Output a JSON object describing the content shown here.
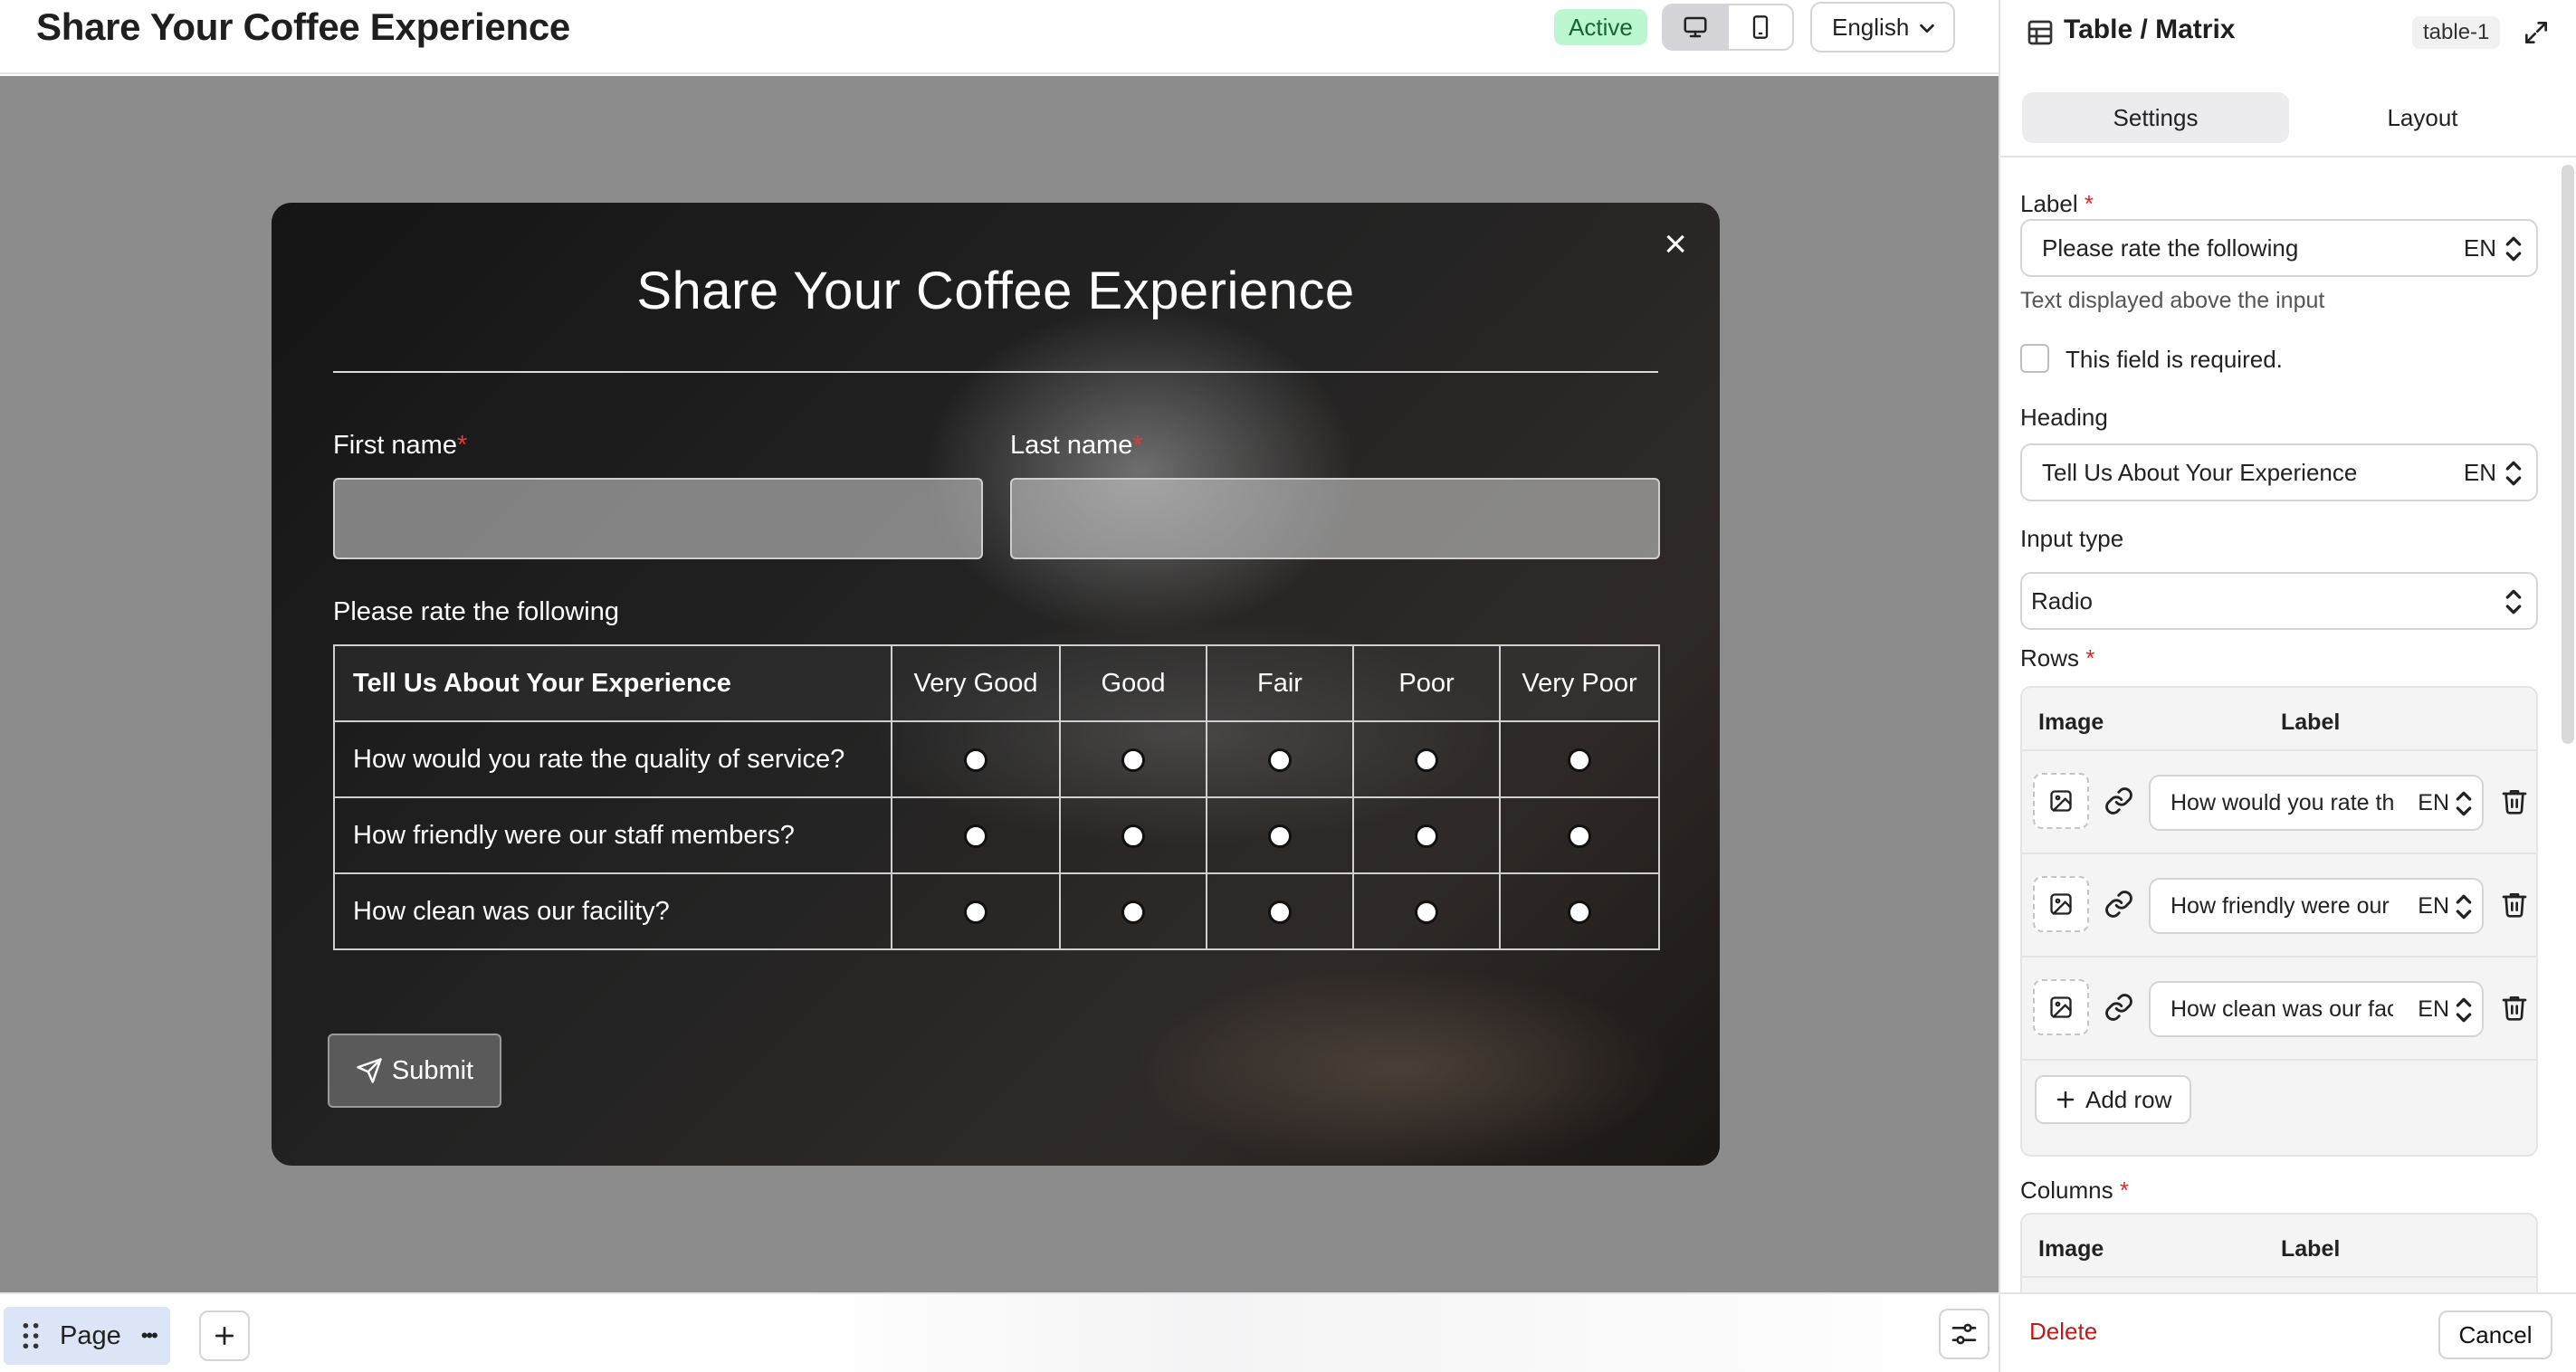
{
  "header": {
    "title": "Share Your Coffee Experience",
    "status": "Active",
    "language": "English",
    "device_modes": [
      "desktop-icon",
      "mobile-icon"
    ],
    "active_device": "desktop"
  },
  "form": {
    "title": "Share Your Coffee Experience",
    "close_symbol": "×",
    "first_name_label": "First name",
    "last_name_label": "Last name",
    "required_mark": "*",
    "rate_label": "Please rate the following",
    "matrix": {
      "heading": "Tell Us About Your Experience",
      "columns": [
        "Very Good",
        "Good",
        "Fair",
        "Poor",
        "Very Poor"
      ],
      "rows": [
        "How would you rate the quality of service?",
        "How friendly were our staff members?",
        "How clean was our facility?"
      ]
    },
    "submit_label": "Submit"
  },
  "bottom_bar": {
    "page_tab_label": "Page",
    "more_symbol": "•••"
  },
  "panel": {
    "title": "Table / Matrix",
    "id_badge": "table-1",
    "tabs": [
      {
        "label": "Settings",
        "active": true
      },
      {
        "label": "Layout",
        "active": false
      }
    ],
    "label_field": {
      "label": "Label",
      "required": "*",
      "value": "Please rate the following",
      "lang": "EN",
      "hint": "Text displayed above the input"
    },
    "required_checkbox": {
      "label": "This field is required.",
      "checked": false
    },
    "heading_field": {
      "label": "Heading",
      "value": "Tell Us About Your Experience",
      "lang": "EN"
    },
    "input_type": {
      "label": "Input type",
      "value": "Radio"
    },
    "rows_section": {
      "label": "Rows",
      "required": "*",
      "col_image": "Image",
      "col_label": "Label",
      "items": [
        {
          "text": "How would you rate the quality of service?",
          "lang": "EN"
        },
        {
          "text": "How friendly were our staff members?",
          "lang": "EN"
        },
        {
          "text": "How clean was our facility?",
          "lang": "EN"
        }
      ],
      "add_label": "Add row"
    },
    "columns_section": {
      "label": "Columns",
      "required": "*",
      "col_image": "Image",
      "col_label": "Label"
    },
    "delete_label": "Delete",
    "cancel_label": "Cancel"
  },
  "colors": {
    "status_bg": "#bbf7d0",
    "status_text": "#166534",
    "required": "#e53935",
    "delete": "#b91c1c",
    "canvas_bg": "#8c8c8c"
  }
}
